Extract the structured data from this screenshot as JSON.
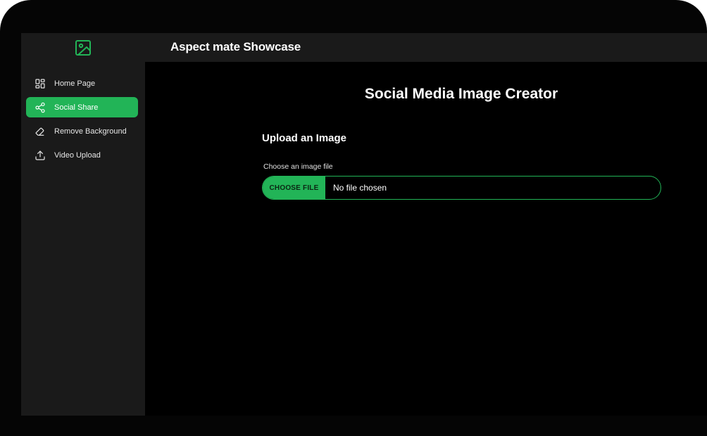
{
  "app": {
    "title": "Aspect mate Showcase",
    "logo_icon": "image-icon",
    "accent_color": "#22b457"
  },
  "sidebar": {
    "items": [
      {
        "label": "Home Page",
        "icon": "dashboard-icon",
        "active": false
      },
      {
        "label": "Social Share",
        "icon": "share-icon",
        "active": true
      },
      {
        "label": "Remove Background",
        "icon": "eraser-icon",
        "active": false
      },
      {
        "label": "Video Upload",
        "icon": "upload-icon",
        "active": false
      }
    ]
  },
  "main": {
    "title": "Social Media Image Creator",
    "section_title": "Upload an Image",
    "file_field": {
      "label": "Choose an image file",
      "button_label": "CHOOSE FILE",
      "status": "No file chosen"
    }
  }
}
